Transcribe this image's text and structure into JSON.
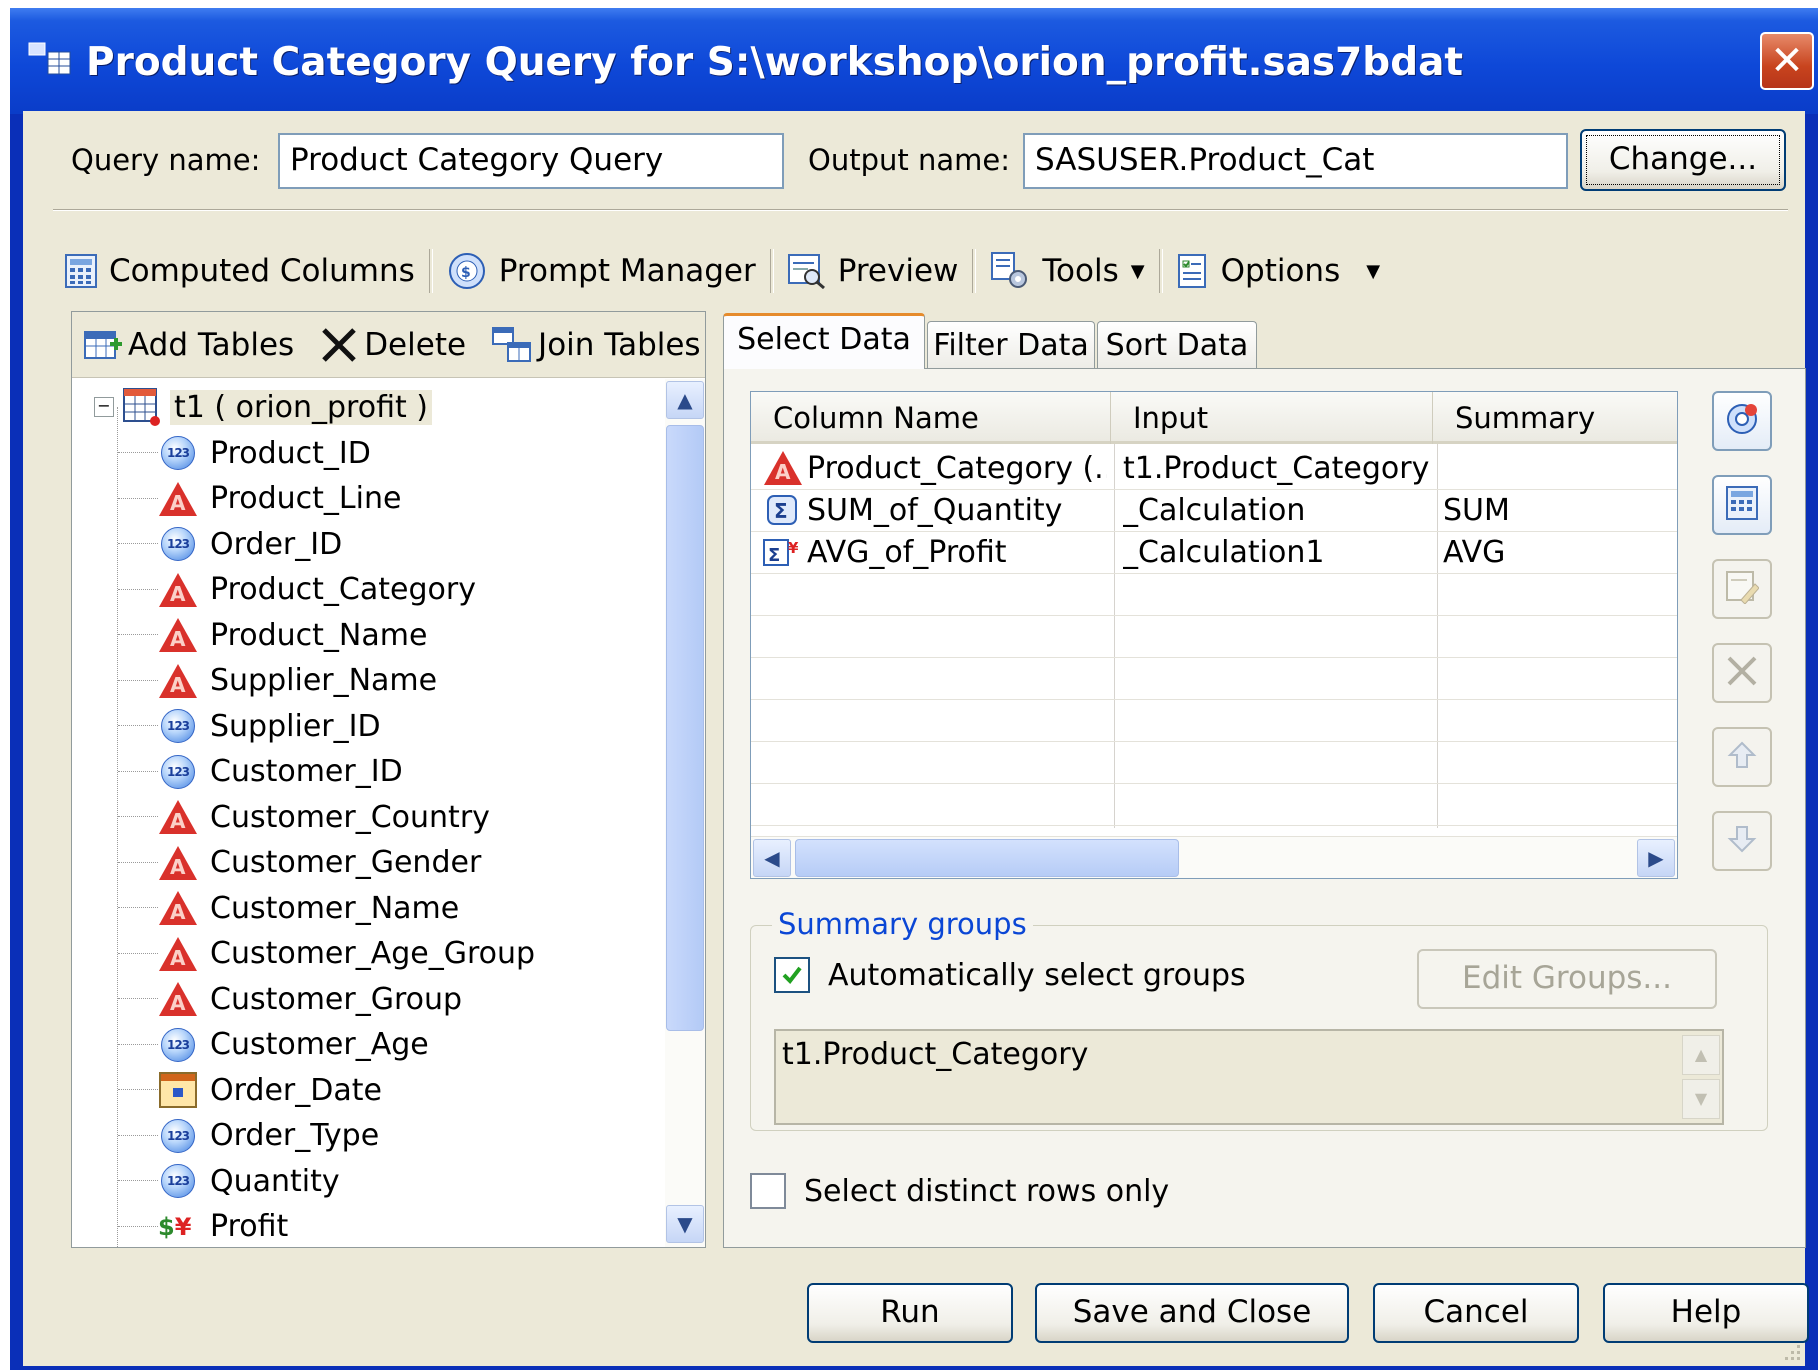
{
  "window": {
    "title": "Product Category Query for S:\\workshop\\orion_profit.sas7bdat",
    "close_glyph": "✕"
  },
  "header": {
    "query_name_label": "Query name:",
    "query_name_value": "Product Category Query",
    "output_name_label": "Output name:",
    "output_name_value": "SASUSER.Product_Cat",
    "change_button": "Change..."
  },
  "toolbar": {
    "computed_columns": "Computed Columns",
    "prompt_manager": "Prompt Manager",
    "preview": "Preview",
    "tools": "Tools",
    "options": "Options"
  },
  "left_toolbar": {
    "add_tables": "Add Tables",
    "delete": "Delete",
    "join_tables": "Join Tables"
  },
  "tree": {
    "root": "t1 ( orion_profit )",
    "items": [
      {
        "label": "Product_ID",
        "icon": "numeric-column-icon"
      },
      {
        "label": "Product_Line",
        "icon": "character-column-icon"
      },
      {
        "label": "Order_ID",
        "icon": "numeric-column-icon"
      },
      {
        "label": "Product_Category",
        "icon": "character-column-icon"
      },
      {
        "label": "Product_Name",
        "icon": "character-column-icon"
      },
      {
        "label": "Supplier_Name",
        "icon": "character-column-icon"
      },
      {
        "label": "Supplier_ID",
        "icon": "numeric-column-icon"
      },
      {
        "label": "Customer_ID",
        "icon": "numeric-column-icon"
      },
      {
        "label": "Customer_Country",
        "icon": "character-column-icon"
      },
      {
        "label": "Customer_Gender",
        "icon": "character-column-icon"
      },
      {
        "label": "Customer_Name",
        "icon": "character-column-icon"
      },
      {
        "label": "Customer_Age_Group",
        "icon": "character-column-icon"
      },
      {
        "label": "Customer_Group",
        "icon": "character-column-icon"
      },
      {
        "label": "Customer_Age",
        "icon": "numeric-column-icon"
      },
      {
        "label": "Order_Date",
        "icon": "date-column-icon"
      },
      {
        "label": "Order_Type",
        "icon": "numeric-column-icon"
      },
      {
        "label": "Quantity",
        "icon": "numeric-column-icon"
      },
      {
        "label": "Profit",
        "icon": "currency-column-icon"
      }
    ]
  },
  "tabs": [
    "Select Data",
    "Filter Data",
    "Sort Data"
  ],
  "grid": {
    "columns": [
      "Column Name",
      "Input",
      "Summary"
    ],
    "rows": [
      {
        "name": "Product_Category (...",
        "input": "t1.Product_Category",
        "summary": "",
        "icon": "character-column-icon"
      },
      {
        "name": "SUM_of_Quantity",
        "input": "_Calculation",
        "summary": "SUM",
        "icon": "sum-calculation-icon"
      },
      {
        "name": "AVG_of_Profit",
        "input": "_Calculation1",
        "summary": "AVG",
        "icon": "currency-calculation-icon"
      }
    ]
  },
  "summary_groups": {
    "legend": "Summary groups",
    "auto_select_label": "Automatically select groups",
    "auto_select_checked": true,
    "edit_groups_button": "Edit Groups...",
    "group_text": "t1.Product_Category"
  },
  "distinct": {
    "label": "Select distinct rows only",
    "checked": false
  },
  "buttons": {
    "run": "Run",
    "save_close": "Save and Close",
    "cancel": "Cancel",
    "help": "Help"
  }
}
